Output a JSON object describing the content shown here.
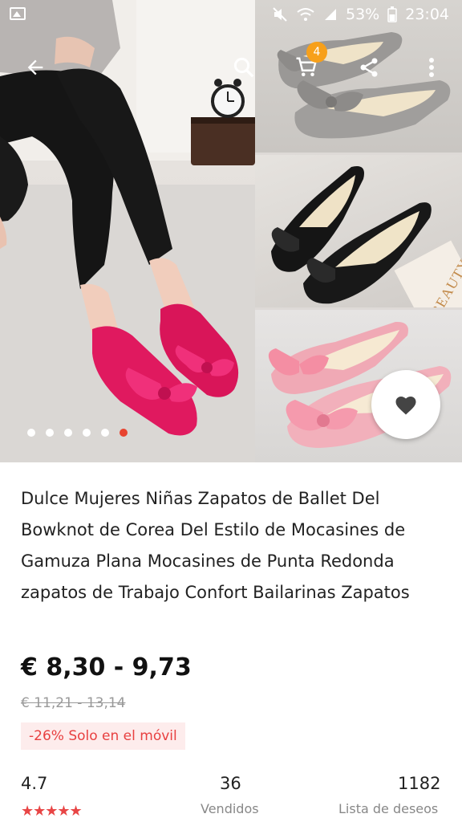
{
  "status_bar": {
    "battery": "53%",
    "time": "23:04"
  },
  "cart": {
    "badge": "4"
  },
  "gallery": {
    "slide_count": 6,
    "active_index": 5
  },
  "product": {
    "title": "Dulce Mujeres Niñas Zapatos de Ballet Del Bowknot de Corea Del Estilo de Mocasines de Gamuza Plana Mocasines de Punta Redonda zapatos de Trabajo Confort Bailarinas Zapatos",
    "price": "€ 8,30 - 9,73",
    "original_price": "€ 11,21 - 13,14",
    "promo": "-26% Solo en el móvil",
    "box_text": "BEAUTY"
  },
  "stats": {
    "rating": "4.7",
    "rating_stars": "★★★★★",
    "sold_value": "36",
    "sold_label": "Vendidos",
    "wishlist_value": "1182",
    "wishlist_label": "Lista de deseos"
  },
  "colors": {
    "accent": "#e8432f",
    "badge": "#f7a01a",
    "pink_shoe": "#e0195f",
    "gray_shoe": "#9a9896",
    "black_shoe": "#151515",
    "light_pink_shoe": "#f0a9b5"
  }
}
